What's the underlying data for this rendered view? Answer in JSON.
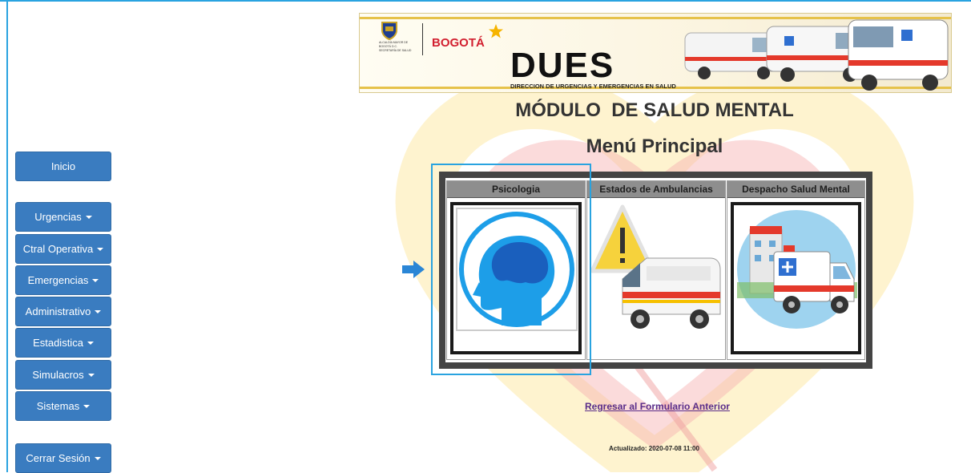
{
  "sidebar": {
    "items": [
      {
        "label": "Inicio",
        "has_caret": false
      },
      {
        "label": "Urgencias",
        "has_caret": true
      },
      {
        "label": "Ctral Operativa",
        "has_caret": true
      },
      {
        "label": "Emergencias",
        "has_caret": true
      },
      {
        "label": "Administrativo",
        "has_caret": true
      },
      {
        "label": "Estadistica",
        "has_caret": true
      },
      {
        "label": "Simulacros",
        "has_caret": true
      },
      {
        "label": "Sistemas",
        "has_caret": true
      },
      {
        "label": "Cerrar Sesión",
        "has_caret": true
      }
    ],
    "button_color": "#3a7cc0"
  },
  "banner": {
    "bogota": "BOGOTÁ",
    "dues": "DUES",
    "dues_subtitle": "DIRECCION DE URGENCIAS Y EMERGENCIAS EN SALUD",
    "alcaldia": "ALCALDÍA MAYOR DE BOGOTÁ D.C. SECRETARÍA DE SALUD"
  },
  "page": {
    "module_title": "MÓDULO  DE SALUD MENTAL",
    "menu_title": "Menú Principal"
  },
  "menu": {
    "columns": [
      {
        "header": "Psicologia",
        "icon": "head-brain-icon"
      },
      {
        "header": "Estados de Ambulancias",
        "icon": "ambulance-warning-icon"
      },
      {
        "header": "Despacho Salud Mental",
        "icon": "hospital-ambulance-icon"
      }
    ]
  },
  "footer": {
    "back_link": "Regresar al Formulario Anterior",
    "updated": "Actualizado: 2020-07-08 11:00"
  },
  "colors": {
    "accent_blue": "#29a3e0",
    "nav_blue": "#3a7cc0",
    "link_purple": "#5a2d8a"
  }
}
